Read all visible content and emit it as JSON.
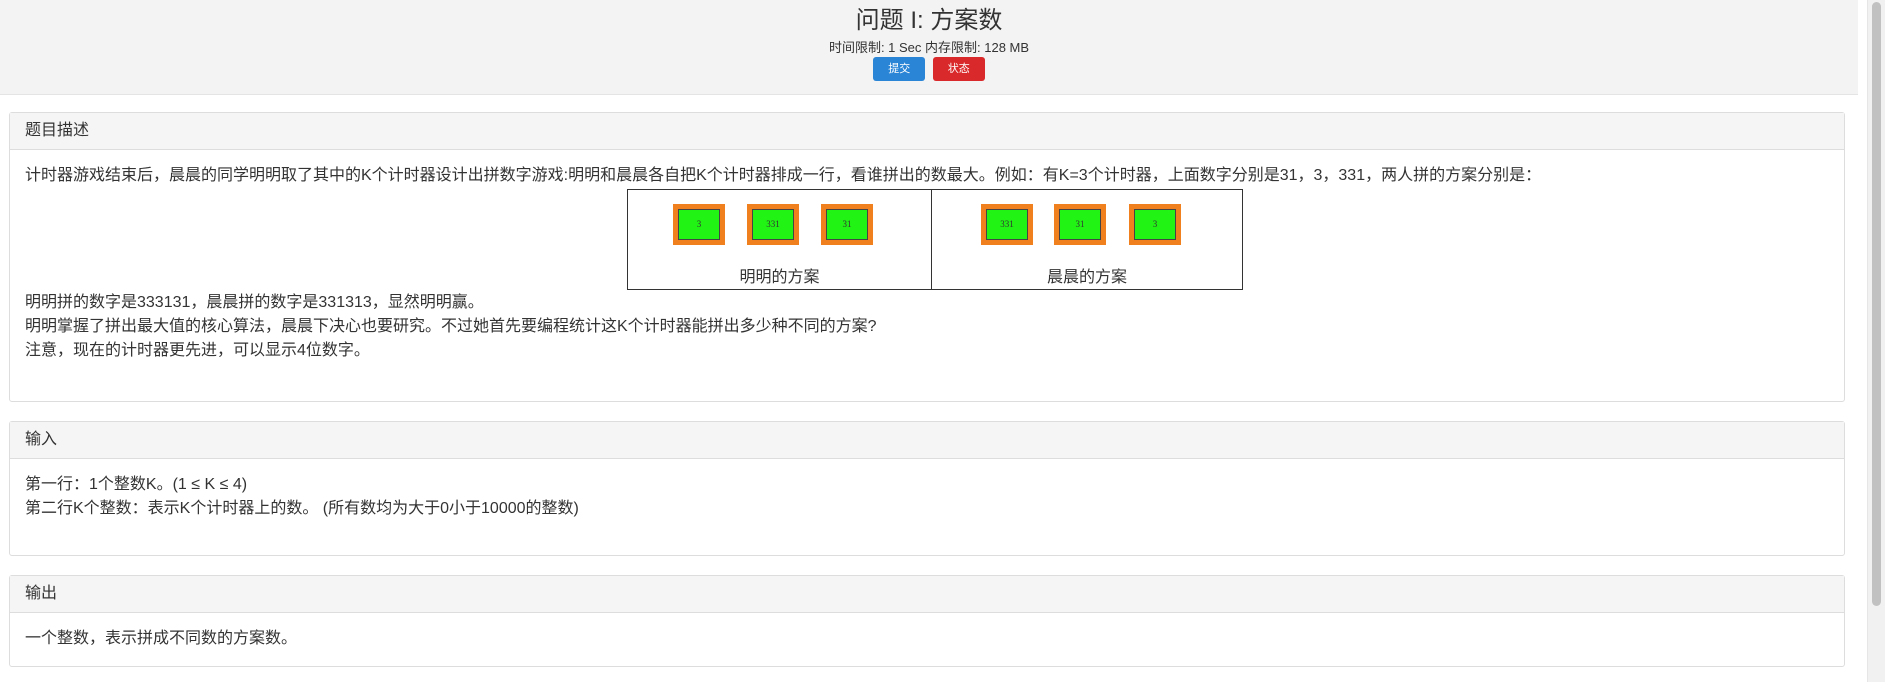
{
  "header": {
    "title": "问题 I: 方案数",
    "limits": "时间限制: 1 Sec  内存限制: 128 MB",
    "submit_label": "提交",
    "status_label": "状态"
  },
  "description": {
    "heading": "题目描述",
    "intro": "计时器游戏结束后，晨晨的同学明明取了其中的K个计时器设计出拼数字游戏:明明和晨晨各自把K个计时器排成一行，看谁拼出的数最大。例如：有K=3个计时器，上面数字分别是31，3，331，两人拼的方案分别是：",
    "figure": {
      "left": {
        "caption": "明明的方案",
        "timers": [
          "3",
          "331",
          "31"
        ]
      },
      "right": {
        "caption": "晨晨的方案",
        "timers": [
          "331",
          "31",
          "3"
        ]
      }
    },
    "lines": [
      "明明拼的数字是333131，晨晨拼的数字是331313，显然明明赢。",
      "明明掌握了拼出最大值的核心算法，晨晨下决心也要研究。不过她首先要编程统计这K个计时器能拼出多少种不同的方案?",
      "注意，现在的计时器更先进，可以显示4位数字。"
    ]
  },
  "input": {
    "heading": "输入",
    "lines": [
      "第一行：1个整数K。(1 ≤  K  ≤  4)",
      "第二行K个整数：表示K个计时器上的数。 (所有数均为大于0小于10000的整数)"
    ]
  },
  "output": {
    "heading": "输出",
    "lines": [
      "一个整数，表示拼成不同数的方案数。"
    ]
  }
}
